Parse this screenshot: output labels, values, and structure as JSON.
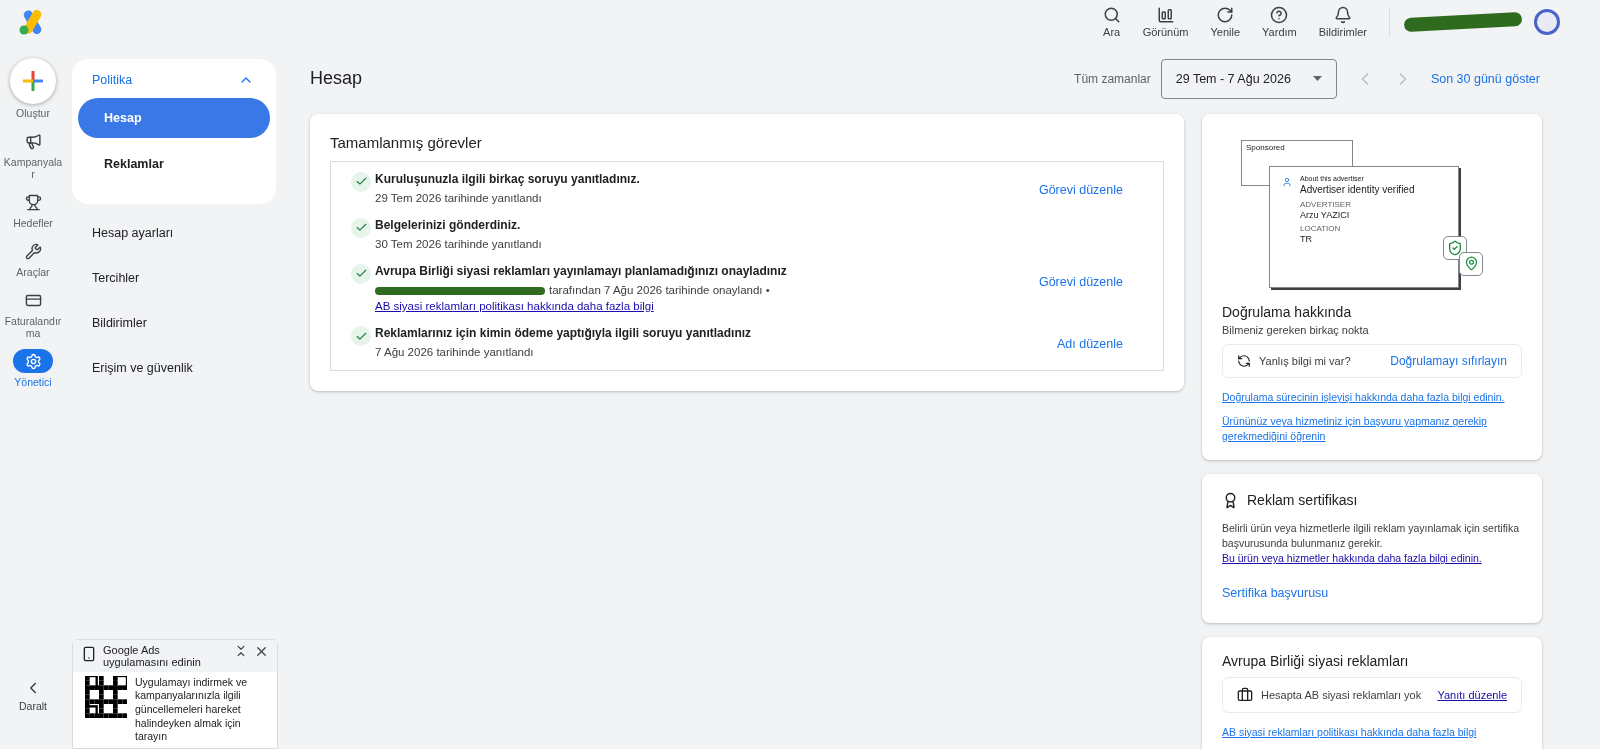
{
  "topbar": {
    "actions": [
      {
        "kind": "search",
        "label": "Ara"
      },
      {
        "kind": "view",
        "label": "Görünüm"
      },
      {
        "kind": "refresh",
        "label": "Yenile"
      },
      {
        "kind": "help",
        "label": "Yardım"
      },
      {
        "kind": "bell",
        "label": "Bildirimler"
      }
    ],
    "account_redacted": true
  },
  "rail": {
    "items": [
      {
        "kind": "create",
        "label": "Oluştur",
        "selected": false
      },
      {
        "kind": "campaigns",
        "label": "Kampanyalar",
        "selected": false
      },
      {
        "kind": "goals",
        "label": "Hedefler",
        "selected": false
      },
      {
        "kind": "tools",
        "label": "Araçlar",
        "selected": false
      },
      {
        "kind": "billing",
        "label": "Faturalandırma",
        "selected": false
      },
      {
        "kind": "admin",
        "label": "Yönetici",
        "selected": true
      }
    ],
    "collapse": "Daralt"
  },
  "nav": {
    "group": {
      "label": "Politika",
      "expanded": true,
      "items": [
        {
          "label": "Hesap",
          "selected": true
        },
        {
          "label": "Reklamlar",
          "selected": false
        }
      ]
    },
    "items": [
      {
        "label": "Hesap ayarları"
      },
      {
        "label": "Tercihler"
      },
      {
        "label": "Bildirimler"
      },
      {
        "label": "Erişim ve güvenlik"
      }
    ]
  },
  "app_promo": {
    "title": "Google Ads uygulamasını edinin",
    "body": "Uygulamayı indirmek ve kampanyalarınızla ilgili güncellemeleri hareket halindeyken almak için tarayın"
  },
  "page": {
    "title": "Hesap",
    "range_label": "Tüm zamanlar",
    "date_range": "29 Tem - 7 Ağu 2026",
    "show_last": "Son 30 günü göster"
  },
  "tasks_card": {
    "title": "Tamamlanmış görevler",
    "tasks": [
      {
        "done": true,
        "title": "Kuruluşunuzla ilgili birkaç soruyu yanıtladınız.",
        "detail": "29 Tem 2026 tarihinde yanıtlandı",
        "action": "Görevi düzenle"
      },
      {
        "done": true,
        "title": "Belgelerinizi gönderdiniz.",
        "detail": "30 Tem 2026 tarihinde yanıtlandı"
      },
      {
        "done": true,
        "title": "Avrupa Birliği siyasi reklamları yayınlamayı planlamadığınızı onayladınız",
        "redacted": true,
        "detail": "tarafından 7 Ağu 2026 tarihinde onaylandı • ",
        "link": "AB siyasi reklamları politikası hakkında daha fazla bilgi",
        "action": "Görevi düzenle"
      },
      {
        "done": true,
        "title": "Reklamlarınız için kimin ödeme yaptığıyla ilgili soruyu yanıtladınız",
        "detail": "7 Ağu 2026 tarihinde yanıtlandı",
        "action": "Adı düzenle"
      }
    ]
  },
  "verification_card": {
    "illustration": {
      "sponsored": "Sponsored",
      "about": "About this advertiser",
      "verified": "Advertiser identity verified",
      "advertiser_label": "ADVERTISER",
      "advertiser": "Arzu YAZICI",
      "location_label": "LOCATION",
      "location": "TR"
    },
    "title": "Doğrulama hakkında",
    "subtitle": "Bilmeniz gereken birkaç nokta",
    "prompt": "Yanlış bilgi mi var?",
    "action": "Doğrulamayı sıfırlayın",
    "links": [
      "Doğrulama sürecinin işleyişi hakkında daha fazla bilgi edinin.",
      "Ürününüz veya hizmetiniz için başvuru yapmanız gerekip gerekmediğini öğrenin"
    ]
  },
  "certificate_card": {
    "title": "Reklam sertifikası",
    "body": "Belirli ürün veya hizmetlerle ilgili reklam yayınlamak için sertifika başvurusunda bulunmanız gerekir. ",
    "link": "Bu ürün veya hizmetler hakkında daha fazla bilgi edinin.",
    "action": "Sertifika başvurusu"
  },
  "eu_card": {
    "title": "Avrupa Birliği siyasi reklamları",
    "status": "Hesapta AB siyasi reklamları yok",
    "action": "Yanıtı düzenle",
    "link": "AB siyasi reklamları politikası hakkında daha fazla bilgi"
  }
}
